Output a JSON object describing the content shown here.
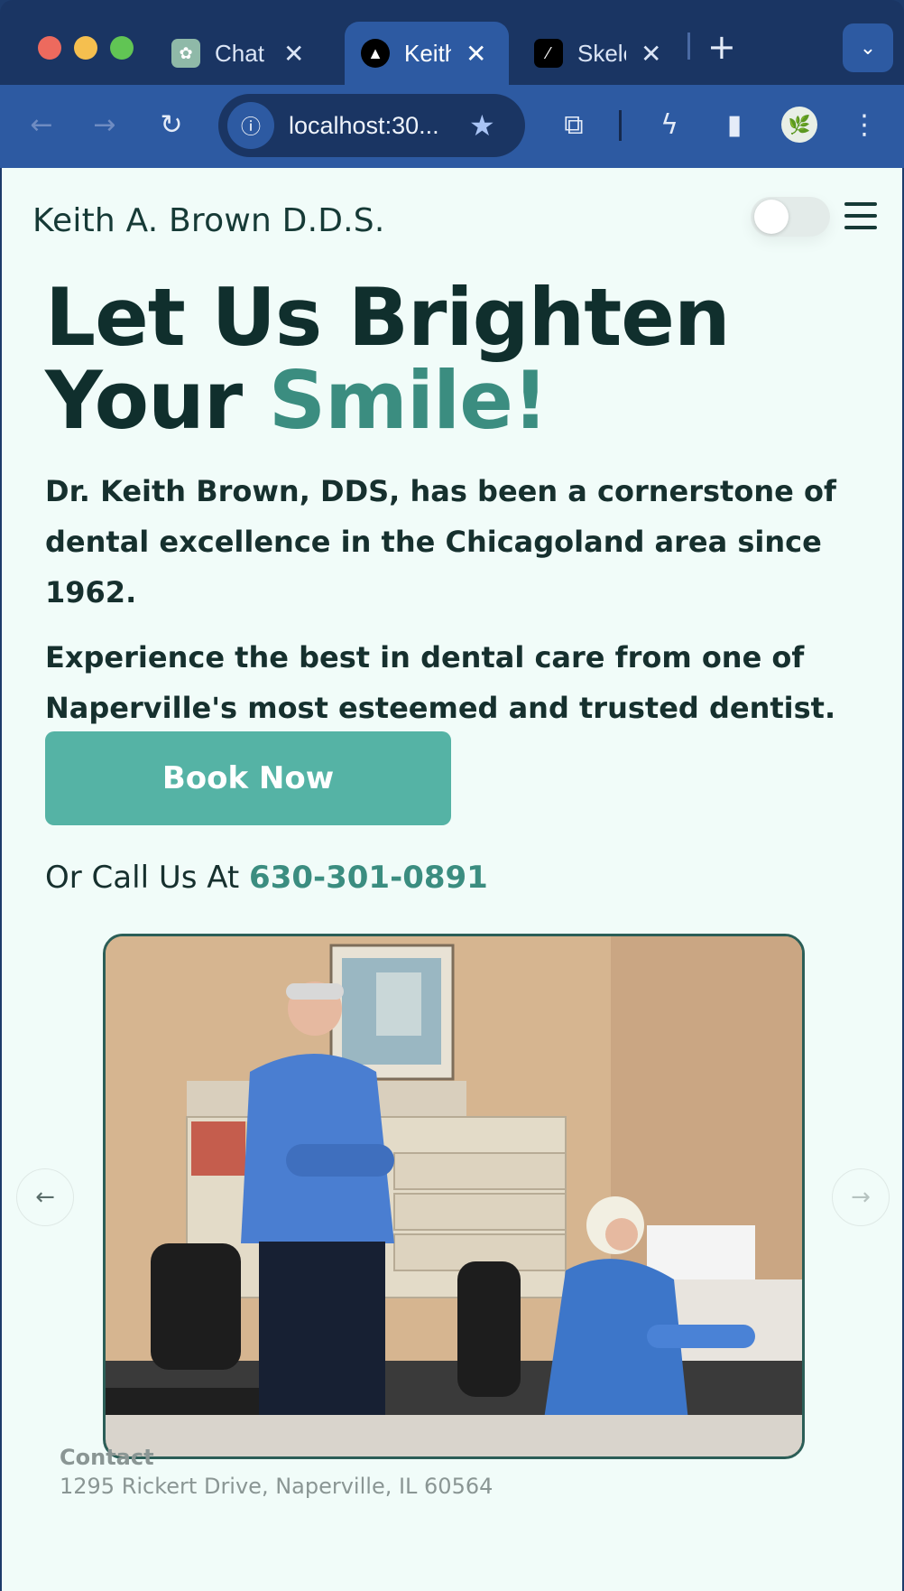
{
  "browser": {
    "tabs": [
      {
        "title": "Chat",
        "favicon": "openai-icon",
        "active": false
      },
      {
        "title": "Keith",
        "favicon": "vercel-triangle-icon",
        "active": true
      },
      {
        "title": "Skele",
        "favicon": "slash-icon",
        "active": false
      }
    ],
    "close_glyph": "✕",
    "new_tab_glyph": "+",
    "dropdown_glyph": "⌄",
    "url": "localhost:30...",
    "icons": {
      "back": "←",
      "forward": "→",
      "reload": "↻",
      "info": "ⓘ",
      "star": "★",
      "extensions": "⧉",
      "bolt": "ϟ",
      "sidebar": "▮",
      "menu": "⋮",
      "avatar": "🌿"
    }
  },
  "site": {
    "brand": "Keith A. Brown D.D.S.",
    "hero": {
      "title_line1": "Let Us Brighten",
      "title_line2_start": "Your ",
      "title_accent": "Smile!",
      "paragraph1": "Dr. Keith Brown, DDS, has been a cornerstone of dental excellence in the Chicagoland area since 1962.",
      "paragraph2": "Experience the best in dental care from one of Naperville's most esteemed and trusted dentist.",
      "book_button": "Book Now",
      "call_prefix": "Or Call Us At ",
      "phone": "630-301-0891"
    },
    "carousel": {
      "prev_glyph": "←",
      "next_glyph": "→"
    },
    "contact": {
      "label": "Contact",
      "address": "1295 Rickert Drive, Naperville, IL 60564"
    }
  },
  "colors": {
    "accent": "#3b8d80",
    "button": "#55b3a5",
    "page_bg": "#f1fcf9",
    "heading": "#102f2d"
  }
}
